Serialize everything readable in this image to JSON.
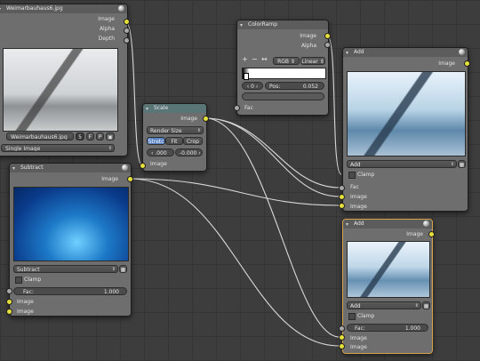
{
  "colors": {
    "socket_color": "#e6e03a",
    "socket_float": "#a8a8a8",
    "wire": "#d8d8d8",
    "active_border": "#d6a24a"
  },
  "image_node": {
    "title": "Weimarbauhaus6.jpg",
    "outputs": [
      "Image",
      "Alpha",
      "Depth"
    ],
    "file": "Weimarbauhaus6.jpg",
    "users": "5",
    "flags": [
      "F",
      "P"
    ],
    "source": "Single Image"
  },
  "scale_node": {
    "title": "Scale",
    "output": "Image",
    "mode": "Render Size",
    "buttons": [
      "Stretc",
      "Fit",
      "Crop"
    ],
    "x_offset": ".000",
    "y_offset": "-0.000",
    "input": "Image"
  },
  "colorramp_node": {
    "title": "ColorRamp",
    "outputs": [
      "Image",
      "Alpha"
    ],
    "controls": [
      "+",
      "−",
      "↔"
    ],
    "color_mode": "RGB",
    "interpolation": "Linear",
    "index": "0",
    "pos_label": "Pos:",
    "pos_value": "0.052",
    "input": "Fac"
  },
  "subtract_node": {
    "title": "Subtract",
    "output": "Image",
    "blend": "Subtract",
    "clamp_label": "Clamp",
    "fac_label": "Fac:",
    "fac_value": "1.000",
    "inputs": [
      "Image",
      "Image"
    ]
  },
  "add_top_node": {
    "title": "Add",
    "output": "Image",
    "blend": "Add",
    "clamp_label": "Clamp",
    "inputs": [
      "Fac",
      "Image",
      "Image"
    ]
  },
  "add_bottom_node": {
    "title": "Add",
    "output": "Image",
    "blend": "Add",
    "clamp_label": "Clamp",
    "fac_label": "Fac:",
    "fac_value": "1.000",
    "inputs": [
      "Image",
      "Image"
    ]
  }
}
